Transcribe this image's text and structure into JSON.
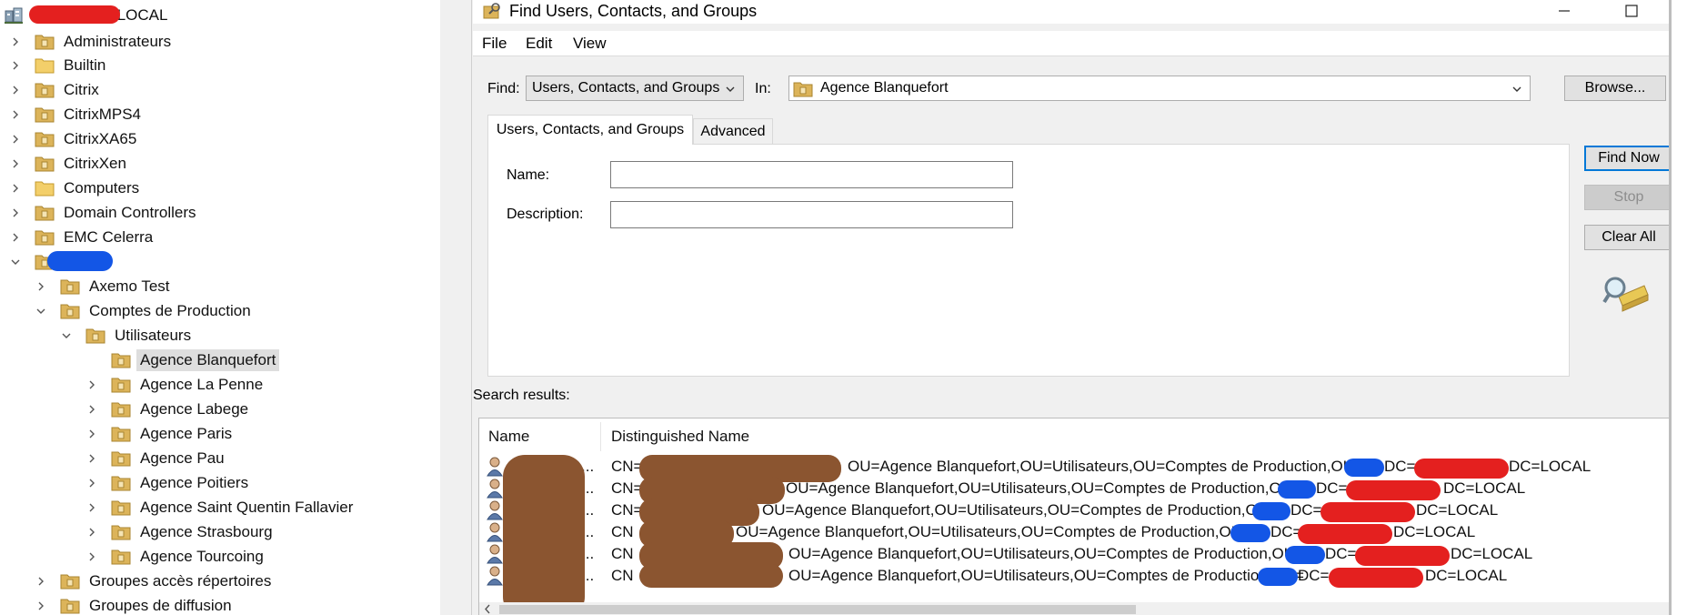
{
  "tree": {
    "root_suffix": ".LOCAL",
    "items": [
      {
        "label": "Administrateurs"
      },
      {
        "label": "Builtin"
      },
      {
        "label": "Citrix"
      },
      {
        "label": "CitrixMPS4"
      },
      {
        "label": "CitrixXA65"
      },
      {
        "label": "CitrixXen"
      },
      {
        "label": "Computers"
      },
      {
        "label": "Domain Controllers"
      },
      {
        "label": "EMC Celerra"
      },
      {
        "label": "Axemo Test"
      },
      {
        "label": "Comptes de Production"
      },
      {
        "label": "Utilisateurs"
      },
      {
        "label": "Agence Blanquefort"
      },
      {
        "label": "Agence La Penne"
      },
      {
        "label": "Agence Labege"
      },
      {
        "label": "Agence Paris"
      },
      {
        "label": "Agence Pau"
      },
      {
        "label": "Agence Poitiers"
      },
      {
        "label": "Agence Saint Quentin Fallavier"
      },
      {
        "label": "Agence Strasbourg"
      },
      {
        "label": "Agence Tourcoing"
      },
      {
        "label": "Groupes accès répertoires"
      },
      {
        "label": "Groupes de diffusion"
      }
    ]
  },
  "dialog": {
    "title": "Find Users, Contacts, and Groups",
    "menu": [
      "File",
      "Edit",
      "View"
    ],
    "find_label": "Find:",
    "find_value": "Users, Contacts, and Groups",
    "in_label": "In:",
    "in_value": "Agence Blanquefort",
    "browse_label": "Browse...",
    "tabs": [
      "Users, Contacts, and Groups",
      "Advanced"
    ],
    "name_label": "Name:",
    "description_label": "Description:",
    "name_value": "",
    "description_value": "",
    "find_now_label": "Find Now",
    "stop_label": "Stop",
    "clear_all_label": "Clear All",
    "search_results_label": "Search results:",
    "columns": [
      "Name",
      "Distinguished Name"
    ],
    "results": [
      {
        "name": "...",
        "dn_prefix": "CN=",
        "dn_mid": "OU=Agence Blanquefort,OU=Utilisateurs,OU=Comptes de Production,OU=",
        "dn_dc1": "DC=",
        "dn_dc2": "DC=LOCAL"
      },
      {
        "name": "...",
        "dn_prefix": "CN=",
        "dn_mid": "OU=Agence Blanquefort,OU=Utilisateurs,OU=Comptes de Production,OU=",
        "dn_dc1": "DC=",
        "dn_dc2": "DC=LOCAL"
      },
      {
        "name": "...",
        "dn_prefix": "CN=",
        "dn_mid": "OU=Agence Blanquefort,OU=Utilisateurs,OU=Comptes de Production,OU=",
        "dn_dc1": "DC=",
        "dn_dc2": "DC=LOCAL"
      },
      {
        "name": "...",
        "dn_prefix": "CN",
        "dn_mid": "OU=Agence Blanquefort,OU=Utilisateurs,OU=Comptes de Production,OU=",
        "dn_dc1": "DC=",
        "dn_dc2": "DC=LOCAL"
      },
      {
        "name": "...",
        "dn_prefix": "CN",
        "dn_mid": "OU=Agence Blanquefort,OU=Utilisateurs,OU=Comptes de Production,OU=",
        "dn_dc1": "DC=",
        "dn_dc2": "DC=LOCAL"
      },
      {
        "name": "...",
        "dn_prefix": "CN",
        "dn_mid": "OU=Agence Blanquefort,OU=Utilisateurs,OU=Comptes de Production,OU=",
        "dn_dc1": "DC=",
        "dn_dc2": "DC=LOCAL"
      }
    ]
  },
  "colors": {
    "folder": "#dcb45a",
    "selection": "#dedede",
    "accent": "#0078d7",
    "redact_red": "#e4201f",
    "redact_blue": "#1356e6",
    "redact_brown": "#8b5530"
  }
}
